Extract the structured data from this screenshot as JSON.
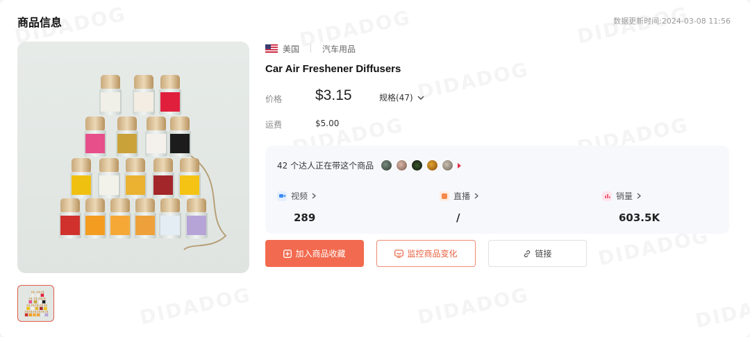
{
  "header": {
    "title": "商品信息",
    "update_time": "数据更新时间:2024-03-08 11:56"
  },
  "watermark_text": "DIDADOG",
  "product": {
    "country": "美国",
    "category": "汽车用品",
    "title": "Car Air Freshener Diffusers",
    "price_label": "价格",
    "price": "$3.15",
    "spec_label": "规格(47)",
    "shipping_label": "运费",
    "shipping": "$5.00"
  },
  "stats": {
    "creators_text": "42 个达人正在带这个商品",
    "video": {
      "label": "视频",
      "value": "289",
      "color": "#3b8cf5"
    },
    "live": {
      "label": "直播",
      "value": "/",
      "color": "#f5884a"
    },
    "sales": {
      "label": "销量",
      "value": "603.5K",
      "color": "#f0607a"
    }
  },
  "actions": {
    "collect": "加入商品收藏",
    "monitor": "监控商品变化",
    "link": "链接"
  },
  "colors": {
    "accent": "#f26a4f",
    "accent_outline": "#e8603f"
  }
}
